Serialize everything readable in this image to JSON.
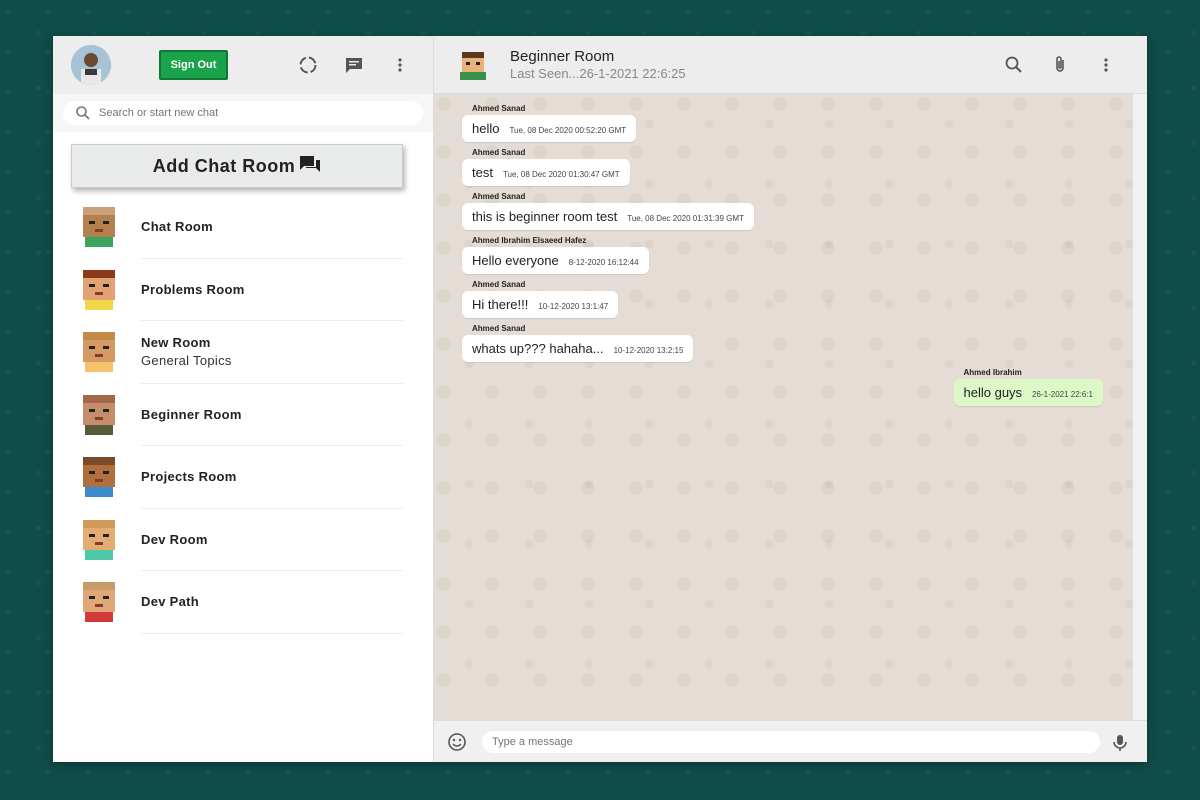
{
  "sidebar": {
    "signout_label": "Sign Out",
    "search_placeholder": "Search or start new chat",
    "add_room_label": "Add Chat Room",
    "rooms": [
      {
        "name": "Chat Room",
        "last": ""
      },
      {
        "name": "Problems Room",
        "last": ""
      },
      {
        "name": "New Room",
        "last": "General Topics"
      },
      {
        "name": "Beginner Room",
        "last": ""
      },
      {
        "name": "Projects Room",
        "last": ""
      },
      {
        "name": "Dev Room",
        "last": ""
      },
      {
        "name": "Dev Path",
        "last": ""
      }
    ],
    "header_icons": [
      "status-icon",
      "chat-icon",
      "more-vert-icon"
    ]
  },
  "chat": {
    "title": "Beginner Room",
    "subtitle": "Last Seen...26-1-2021 22:6:25",
    "header_icons": [
      "search-icon",
      "attach-icon",
      "more-vert-icon"
    ],
    "messages": [
      {
        "sender": "Ahmed Sanad",
        "text": "hello",
        "time": "Tue, 08 Dec 2020 00:52:20 GMT",
        "mine": false
      },
      {
        "sender": "Ahmed Sanad",
        "text": "test",
        "time": "Tue, 08 Dec 2020 01:30:47 GMT",
        "mine": false
      },
      {
        "sender": "Ahmed Sanad",
        "text": "this is beginner room test",
        "time": "Tue, 08 Dec 2020 01:31:39 GMT",
        "mine": false
      },
      {
        "sender": "Ahmed Ibrahim Elsaeed Hafez",
        "text": "Hello everyone",
        "time": "8-12-2020 16:12:44",
        "mine": false
      },
      {
        "sender": "Ahmed Sanad",
        "text": "Hi there!!!",
        "time": "10-12-2020 13:1:47",
        "mine": false
      },
      {
        "sender": "Ahmed Sanad",
        "text": "whats up??? hahaha...",
        "time": "10-12-2020 13:2:15",
        "mine": false
      },
      {
        "sender": "Ahmed Ibrahim",
        "text": "hello guys",
        "time": "26-1-2021 22:6:1",
        "mine": true
      }
    ],
    "input_placeholder": "Type a message"
  },
  "colors": {
    "signout_bg": "#1aa34a",
    "own_bubble": "#dcf8c6",
    "chat_bg": "#e5ddd5",
    "page_bg": "#0f4d4a"
  }
}
